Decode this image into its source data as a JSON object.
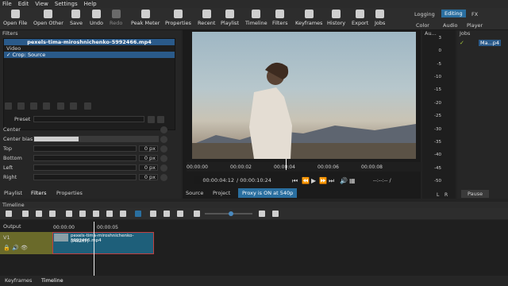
{
  "menu": [
    "File",
    "Edit",
    "View",
    "Settings",
    "Help"
  ],
  "toolbar": {
    "buttons": [
      {
        "label": "Open File",
        "icon": "folder-icon",
        "enabled": true
      },
      {
        "label": "Open Other",
        "icon": "open-other-icon",
        "enabled": true
      },
      {
        "label": "Save",
        "icon": "save-icon",
        "enabled": true
      },
      {
        "label": "Undo",
        "icon": "undo-icon",
        "enabled": true
      },
      {
        "label": "Redo",
        "icon": "redo-icon",
        "enabled": false
      },
      {
        "label": "Peak Meter",
        "icon": "peak-meter-icon",
        "enabled": true
      },
      {
        "label": "Properties",
        "icon": "properties-icon",
        "enabled": true
      },
      {
        "label": "Recent",
        "icon": "recent-icon",
        "enabled": true
      },
      {
        "label": "Playlist",
        "icon": "playlist-icon",
        "enabled": true
      },
      {
        "label": "Timeline",
        "icon": "timeline-icon",
        "enabled": true
      },
      {
        "label": "Filters",
        "icon": "filters-icon",
        "enabled": true
      },
      {
        "label": "Keyframes",
        "icon": "keyframes-icon",
        "enabled": true
      },
      {
        "label": "History",
        "icon": "history-icon",
        "enabled": true
      },
      {
        "label": "Export",
        "icon": "export-icon",
        "enabled": true
      },
      {
        "label": "Jobs",
        "icon": "jobs-icon",
        "enabled": true
      }
    ],
    "layouts": [
      "Logging",
      "Editing",
      "FX",
      "Color",
      "Audio",
      "Player"
    ],
    "active_layout": "Editing"
  },
  "filters": {
    "title": "Filters",
    "selected_clip": "pexels-tima-miroshnichenko-5992466.mp4",
    "group": "Video",
    "item": "Crop: Source",
    "preset_label": "Preset",
    "params": [
      {
        "label": "Center",
        "value": ""
      },
      {
        "label": "Center bias",
        "value": ""
      },
      {
        "label": "Top",
        "value": "0 px"
      },
      {
        "label": "Bottom",
        "value": "0 px"
      },
      {
        "label": "Left",
        "value": "0 px"
      },
      {
        "label": "Right",
        "value": "0 px"
      }
    ]
  },
  "left_tabs": [
    "Playlist",
    "Filters",
    "Properties"
  ],
  "player": {
    "ruler": [
      "00:00:00",
      "00:00:02",
      "00:00:04",
      "00:00:06",
      "00:00:08"
    ],
    "position": "00:00:04:12",
    "duration": "/ 00:00:10:24",
    "in_out": "--:--:-- /",
    "tabs": [
      "Source",
      "Project"
    ],
    "proxy_status": "Proxy is ON at 540p"
  },
  "audio_meter": {
    "title": "Au...",
    "scale": [
      "3",
      "0",
      "-5",
      "-10",
      "-15",
      "-20",
      "-25",
      "-30",
      "-35",
      "-40",
      "-45",
      "-50"
    ],
    "channels": [
      "L",
      "R"
    ]
  },
  "jobs": {
    "title": "Jobs",
    "item": "Ma...p4",
    "pause_label": "Pause"
  },
  "timeline": {
    "title": "Timeline",
    "ruler": [
      "00:00:00",
      "00:00:05"
    ],
    "output_label": "Output",
    "track": "V1",
    "clip_name": "pexels-tima-miroshnichenko-5992466.mp4",
    "clip_tag": "(PROXY)"
  },
  "bottom_tabs": [
    "Keyframes",
    "Timeline"
  ],
  "colors": {
    "accent": "#2a5a8a",
    "proxy_bg": "#2a6fa0",
    "clip": "#1e5f7a",
    "clip_border": "#c04040"
  }
}
